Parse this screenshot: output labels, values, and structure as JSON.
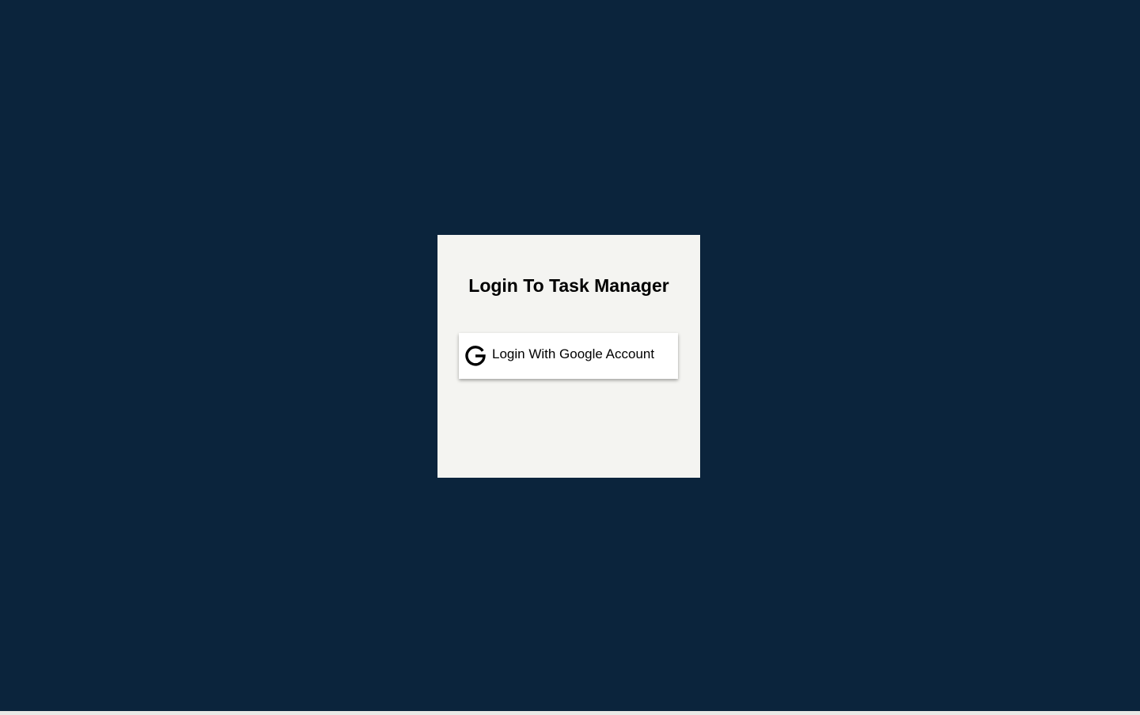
{
  "page": {
    "background_color": "#0b243c",
    "card_color": "#f4f4f1"
  },
  "login": {
    "title": "Login To Task Manager",
    "google_button": {
      "label": "Login With Google Account",
      "icon": "google-g-icon"
    }
  }
}
